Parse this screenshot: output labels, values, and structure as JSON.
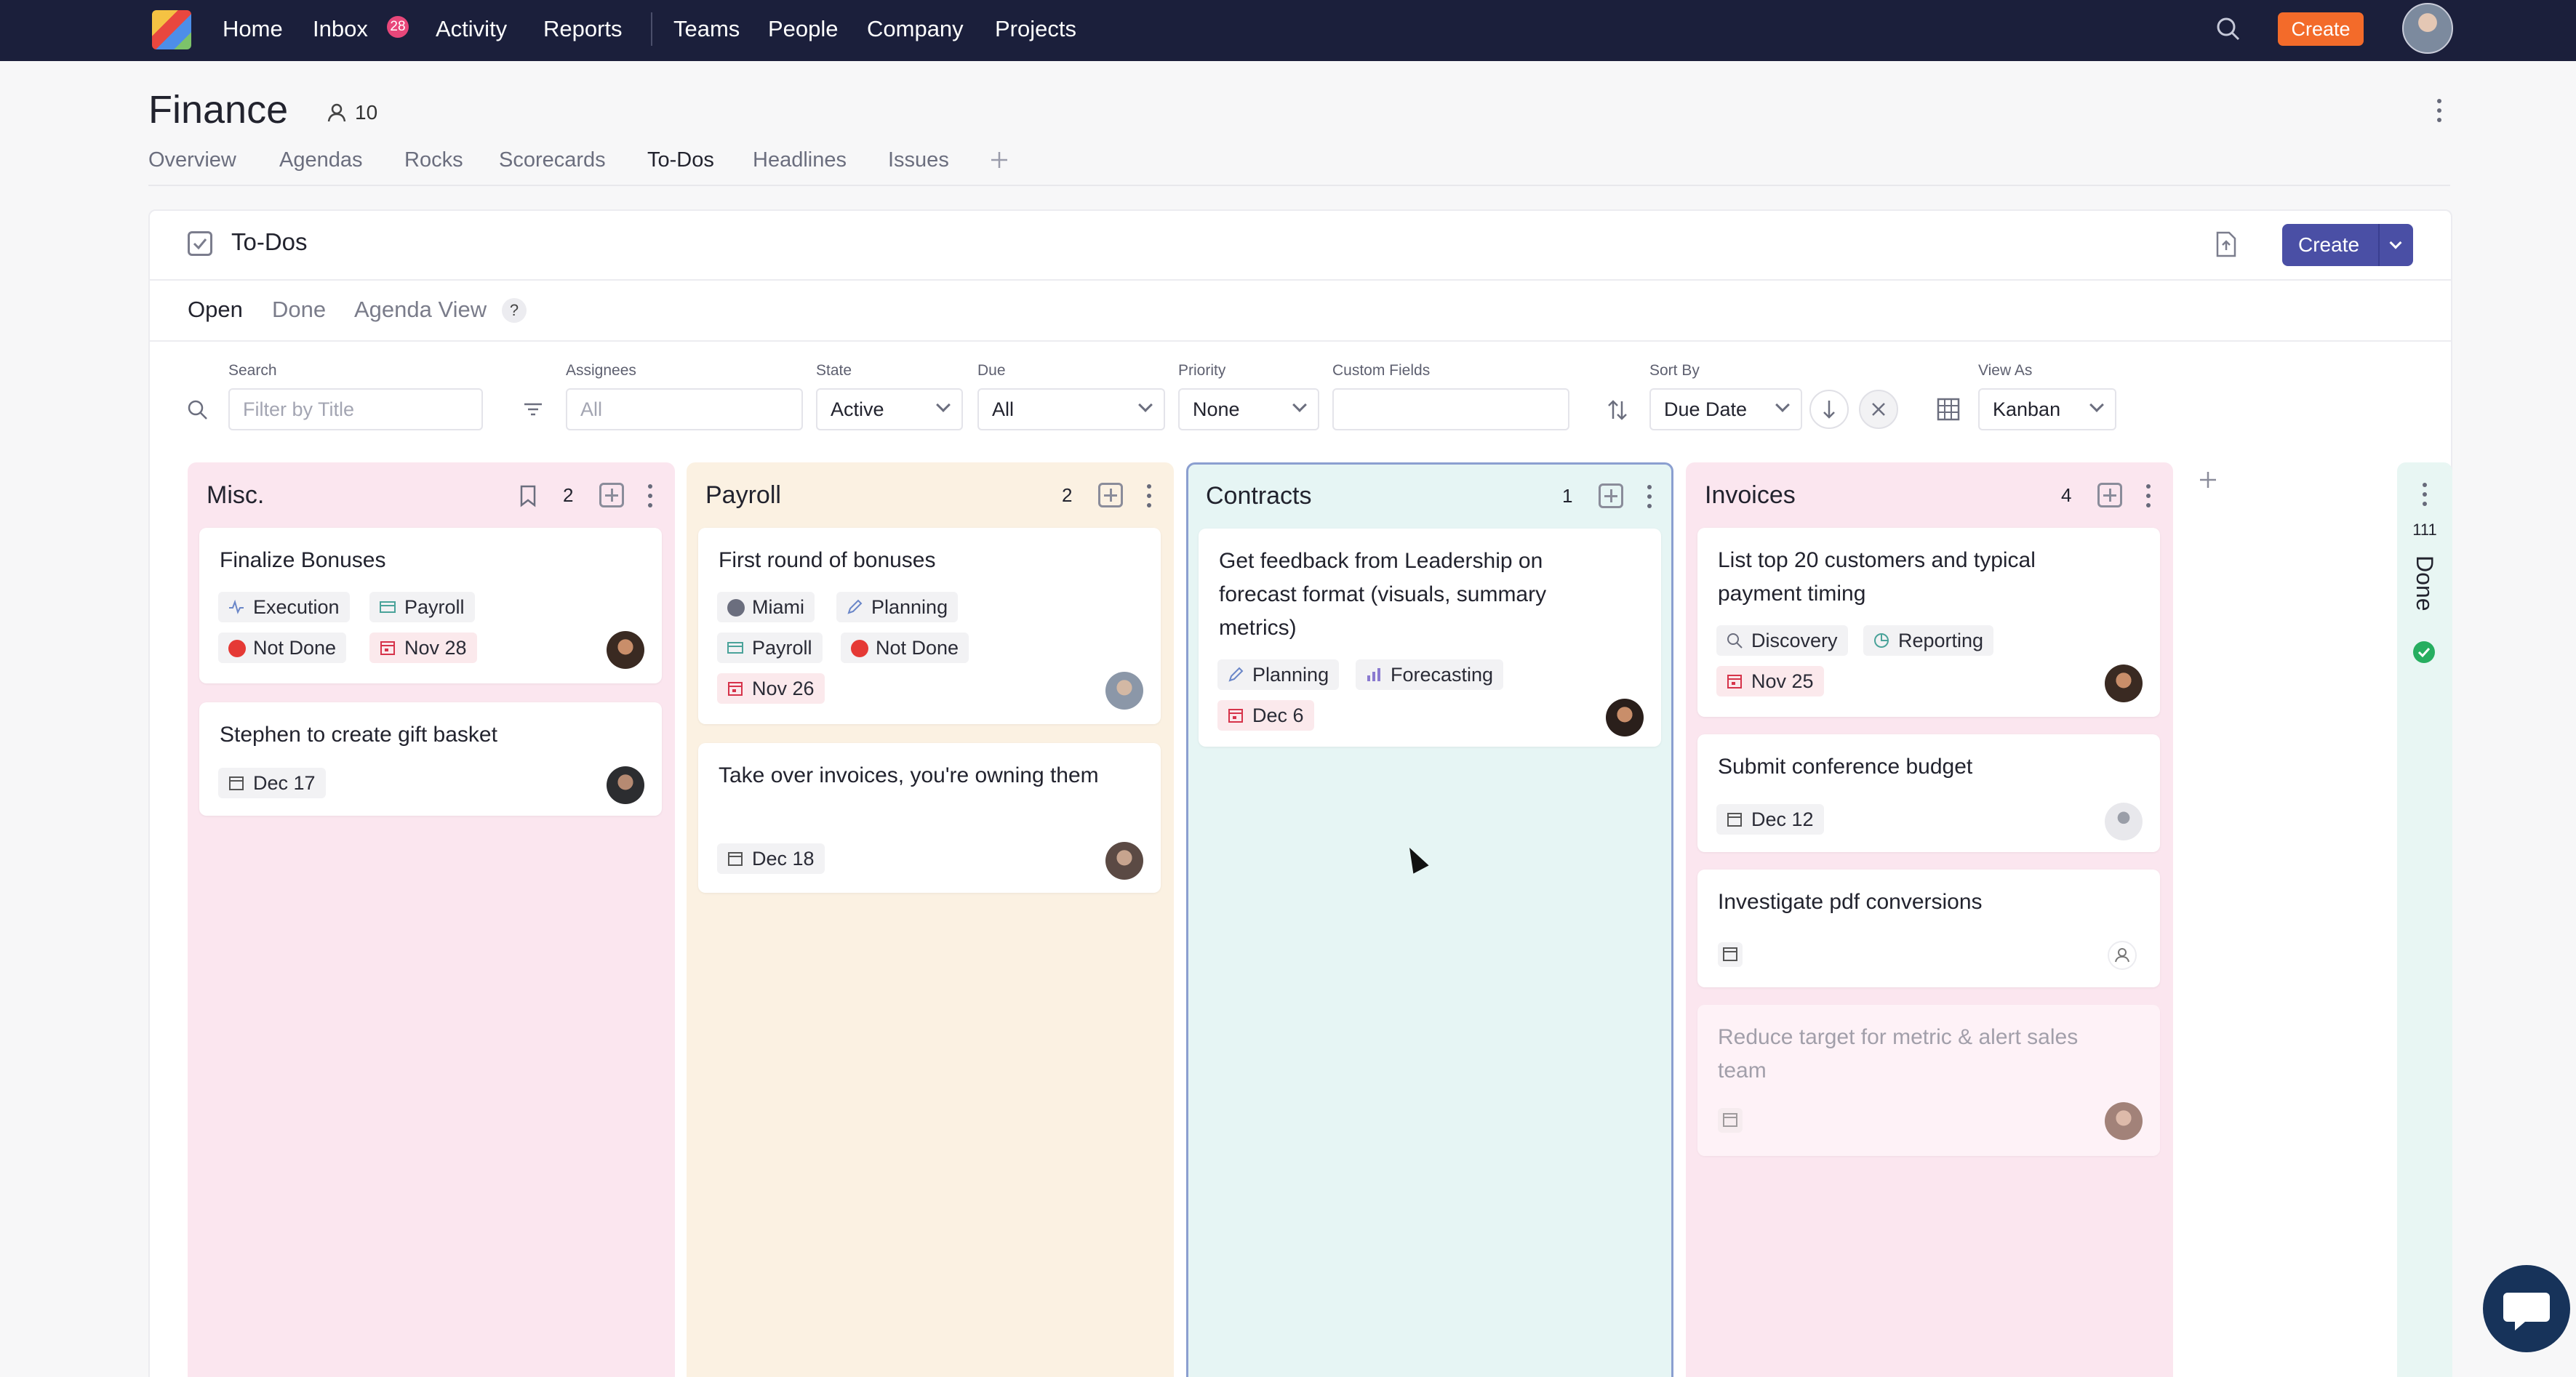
{
  "nav": {
    "links": [
      "Home",
      "Inbox",
      "Activity",
      "Reports",
      "Teams",
      "People",
      "Company",
      "Projects"
    ],
    "inbox_badge": "28",
    "create_label": "Create"
  },
  "page": {
    "title": "Finance",
    "member_count": "10",
    "tabs": [
      "Overview",
      "Agendas",
      "Rocks",
      "Scorecards",
      "To-Dos",
      "Headlines",
      "Issues"
    ]
  },
  "panel": {
    "title": "To-Dos",
    "create_label": "Create",
    "view_tabs": [
      "Open",
      "Done",
      "Agenda View"
    ],
    "help": "?"
  },
  "filters": {
    "search_label": "Search",
    "search_placeholder": "Filter by Title",
    "assignees_label": "Assignees",
    "assignees_value": "All",
    "state_label": "State",
    "state_value": "Active",
    "due_label": "Due",
    "due_value": "All",
    "priority_label": "Priority",
    "priority_value": "None",
    "custom_label": "Custom Fields",
    "custom_value": "",
    "sort_label": "Sort By",
    "sort_value": "Due Date",
    "view_label": "View As",
    "view_value": "Kanban"
  },
  "colors": {
    "misc": "#fbe6ef",
    "payroll": "#fbf1e2",
    "contracts": "#e6f5f4",
    "invoices": "#fbe6ef",
    "not_done": "#e53935",
    "accent": "#4a4fa5"
  },
  "columns": [
    {
      "title": "Misc.",
      "count": "2",
      "cards": [
        {
          "title": "Finalize Bonuses",
          "chips": [
            "Execution",
            "Payroll",
            "Not Done",
            "Nov 28"
          ]
        },
        {
          "title": "Stephen to create gift basket",
          "chips": [
            "Dec 17"
          ]
        }
      ]
    },
    {
      "title": "Payroll",
      "count": "2",
      "cards": [
        {
          "title": "First round of bonuses",
          "chips": [
            "Miami",
            "Planning",
            "Payroll",
            "Not Done",
            "Nov 26"
          ]
        },
        {
          "title": "Take over invoices, you're owning them",
          "chips": [
            "Dec 18"
          ]
        }
      ]
    },
    {
      "title": "Contracts",
      "count": "1",
      "cards": [
        {
          "title": "Get feedback from Leadership on forecast format (visuals, summary metrics)",
          "chips": [
            "Planning",
            "Forecasting",
            "Dec 6"
          ]
        }
      ]
    },
    {
      "title": "Invoices",
      "count": "4",
      "cards": [
        {
          "title": "List top 20 customers and typical payment timing",
          "chips": [
            "Discovery",
            "Reporting",
            "Nov 25"
          ]
        },
        {
          "title": "Submit conference budget",
          "chips": [
            "Dec 12"
          ]
        },
        {
          "title": "Investigate pdf conversions",
          "chips": []
        },
        {
          "title": "Reduce target for metric & alert sales team",
          "chips": []
        }
      ]
    }
  ],
  "done_column": {
    "label": "Done",
    "count": "111"
  }
}
